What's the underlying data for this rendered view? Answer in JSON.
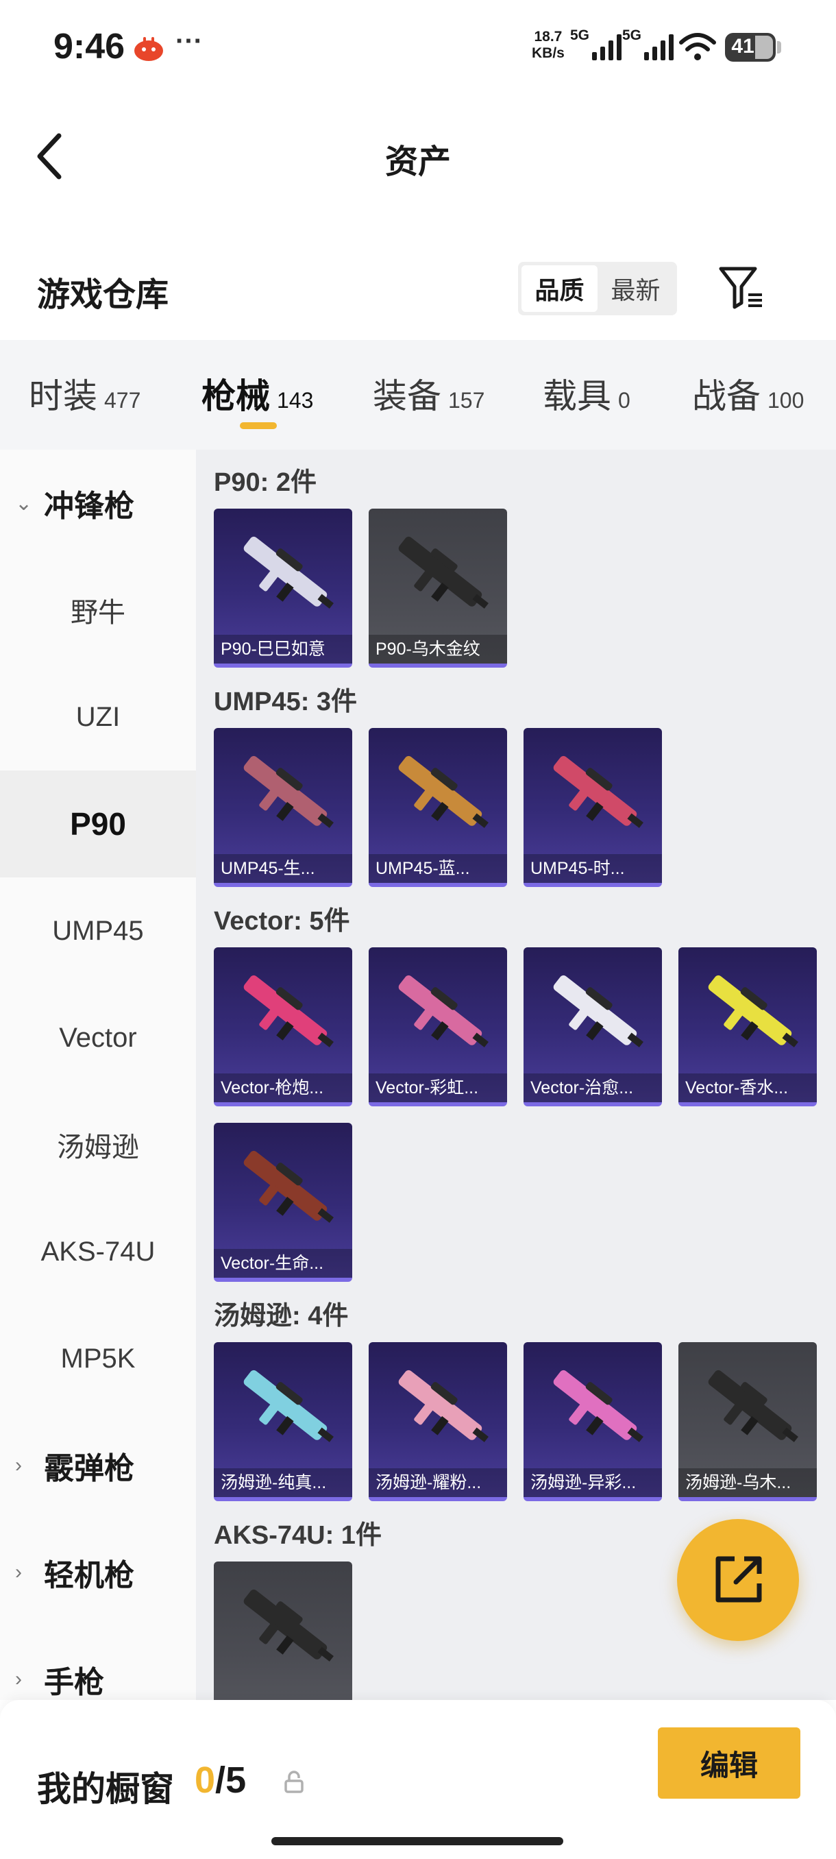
{
  "status_bar": {
    "time": "9:46",
    "more": "···",
    "speed_value": "18.7",
    "speed_unit": "KB/s",
    "signal1_label": "5G",
    "signal2_label": "5G",
    "battery": "41",
    "icons": [
      "app-notification-icon",
      "signal-icon",
      "wifi-icon",
      "battery-icon"
    ]
  },
  "nav": {
    "back_icon": "back-arrow-icon",
    "title": "资产"
  },
  "warehouse": {
    "title": "游戏仓库",
    "sort_options": [
      "品质",
      "最新"
    ],
    "sort_selected": "品质",
    "filter_icon": "filter-icon"
  },
  "categories": [
    {
      "label": "时装",
      "count": "477"
    },
    {
      "label": "枪械",
      "count": "143"
    },
    {
      "label": "装备",
      "count": "157"
    },
    {
      "label": "载具",
      "count": "0"
    },
    {
      "label": "战备",
      "count": "100"
    }
  ],
  "active_category": "枪械",
  "sidebar": {
    "items": [
      {
        "label": "冲锋枪",
        "type": "group",
        "expanded": true
      },
      {
        "label": "野牛",
        "type": "item"
      },
      {
        "label": "UZI",
        "type": "item"
      },
      {
        "label": "P90",
        "type": "item",
        "selected": true
      },
      {
        "label": "UMP45",
        "type": "item"
      },
      {
        "label": "Vector",
        "type": "item"
      },
      {
        "label": "汤姆逊",
        "type": "item"
      },
      {
        "label": "AKS-74U",
        "type": "item"
      },
      {
        "label": "MP5K",
        "type": "item"
      },
      {
        "label": "霰弹枪",
        "type": "group",
        "expanded": false
      },
      {
        "label": "轻机枪",
        "type": "group",
        "expanded": false
      },
      {
        "label": "手枪",
        "type": "group",
        "expanded": false
      }
    ]
  },
  "sections": [
    {
      "title": "P90: 2件",
      "items": [
        {
          "name": "P90-巳巳如意",
          "rarity": "purple",
          "color": "#d8d8e8"
        },
        {
          "name": "P90-乌木金纹",
          "rarity": "gray",
          "color": "#2a2a2a"
        }
      ]
    },
    {
      "title": "UMP45: 3件",
      "items": [
        {
          "name": "UMP45-生...",
          "rarity": "purple",
          "color": "#b06070"
        },
        {
          "name": "UMP45-蓝...",
          "rarity": "purple",
          "color": "#c88a3a"
        },
        {
          "name": "UMP45-时...",
          "rarity": "purple",
          "color": "#d04a68"
        }
      ]
    },
    {
      "title": "Vector: 5件",
      "items": [
        {
          "name": "Vector-枪炮...",
          "rarity": "purple",
          "color": "#e0407a"
        },
        {
          "name": "Vector-彩虹...",
          "rarity": "purple",
          "color": "#d86aa0"
        },
        {
          "name": "Vector-治愈...",
          "rarity": "purple",
          "color": "#e8e8f0"
        },
        {
          "name": "Vector-香水...",
          "rarity": "purple",
          "color": "#e8e040"
        },
        {
          "name": "Vector-生命...",
          "rarity": "purple",
          "color": "#8a3a2a"
        }
      ]
    },
    {
      "title": "汤姆逊: 4件",
      "items": [
        {
          "name": "汤姆逊-纯真...",
          "rarity": "purple",
          "color": "#80d0e0"
        },
        {
          "name": "汤姆逊-耀粉...",
          "rarity": "purple",
          "color": "#e8a0b8"
        },
        {
          "name": "汤姆逊-异彩...",
          "rarity": "purple",
          "color": "#e070c0"
        },
        {
          "name": "汤姆逊-乌木...",
          "rarity": "gray",
          "color": "#2a2a2a"
        }
      ]
    },
    {
      "title": "AKS-74U: 1件",
      "items": [
        {
          "name": "",
          "rarity": "gray",
          "color": "#2a2a2a"
        }
      ]
    }
  ],
  "fab": {
    "icon": "share-export-icon"
  },
  "showcase": {
    "label": "我的橱窗",
    "current": "0",
    "separator": "/",
    "max": "5",
    "lock_icon": "lock-icon",
    "edit_label": "编辑"
  },
  "accent_color": "#f2b630"
}
